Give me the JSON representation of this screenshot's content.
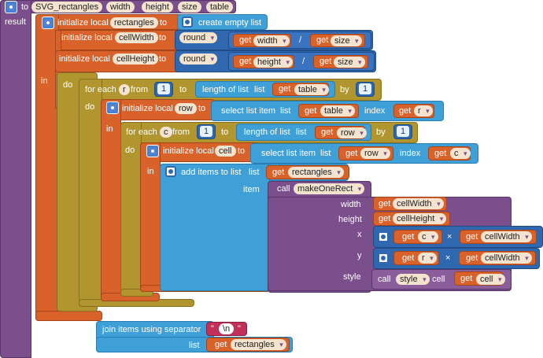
{
  "procedure": {
    "to_label": "to",
    "name": "SVG_rectangles",
    "params": [
      "width",
      "height",
      "size",
      "table"
    ],
    "result_label": "result"
  },
  "init_rectangles": {
    "label": "initialize local",
    "var": "rectangles",
    "to_label": "to",
    "value": "create empty list"
  },
  "init_cellwidth": {
    "label": "initialize local",
    "var": "cellWidth",
    "to_label": "to",
    "fn": "round",
    "get_label": "get",
    "a": "width",
    "op": "/",
    "b": "size"
  },
  "init_cellheight": {
    "label": "initialize local",
    "var": "cellHeight",
    "to_label": "to",
    "fn": "round",
    "get_label": "get",
    "a": "height",
    "op": "/",
    "b": "size"
  },
  "in_label": "in",
  "do_label": "do",
  "foreach_r": {
    "label": "for each",
    "var": "r",
    "from_label": "from",
    "from": "1",
    "to_label": "to",
    "length_label": "length of list",
    "list_label": "list",
    "get_label": "get",
    "list_var": "table",
    "by_label": "by",
    "by": "1"
  },
  "init_row": {
    "label": "initialize local",
    "var": "row",
    "to_label": "to",
    "select_label": "select list item",
    "list_label": "list",
    "get_label": "get",
    "list_var": "table",
    "index_label": "index",
    "index_var": "r"
  },
  "foreach_c": {
    "label": "for each",
    "var": "c",
    "from_label": "from",
    "from": "1",
    "to_label": "to",
    "length_label": "length of list",
    "list_label": "list",
    "get_label": "get",
    "list_var": "row",
    "by_label": "by",
    "by": "1"
  },
  "init_cell": {
    "label": "initialize local",
    "var": "cell",
    "to_label": "to",
    "select_label": "select list item",
    "list_label": "list",
    "get_label": "get",
    "list_var": "row",
    "index_label": "index",
    "index_var": "c"
  },
  "add_items": {
    "label": "add items to list",
    "list_label": "list",
    "get_label": "get",
    "list_var": "rectangles",
    "item_label": "item"
  },
  "call_make": {
    "call_label": "call",
    "proc": "makeOneRect",
    "width_label": "width",
    "width_val": "cellWidth",
    "height_label": "height",
    "height_val": "cellHeight",
    "x_label": "x",
    "x_a": "c",
    "x_op": "×",
    "x_b": "cellWidth",
    "y_label": "y",
    "y_a": "r",
    "y_op": "×",
    "y_b": "cellWidth",
    "style_label": "style",
    "style_proc": "style",
    "cell_label": "cell",
    "cell_var": "cell",
    "get_label": "get"
  },
  "join": {
    "result_label": "result",
    "label": "join items using separator",
    "separator": "\\n",
    "list_label": "list",
    "get_label": "get",
    "list_var": "rectangles"
  }
}
